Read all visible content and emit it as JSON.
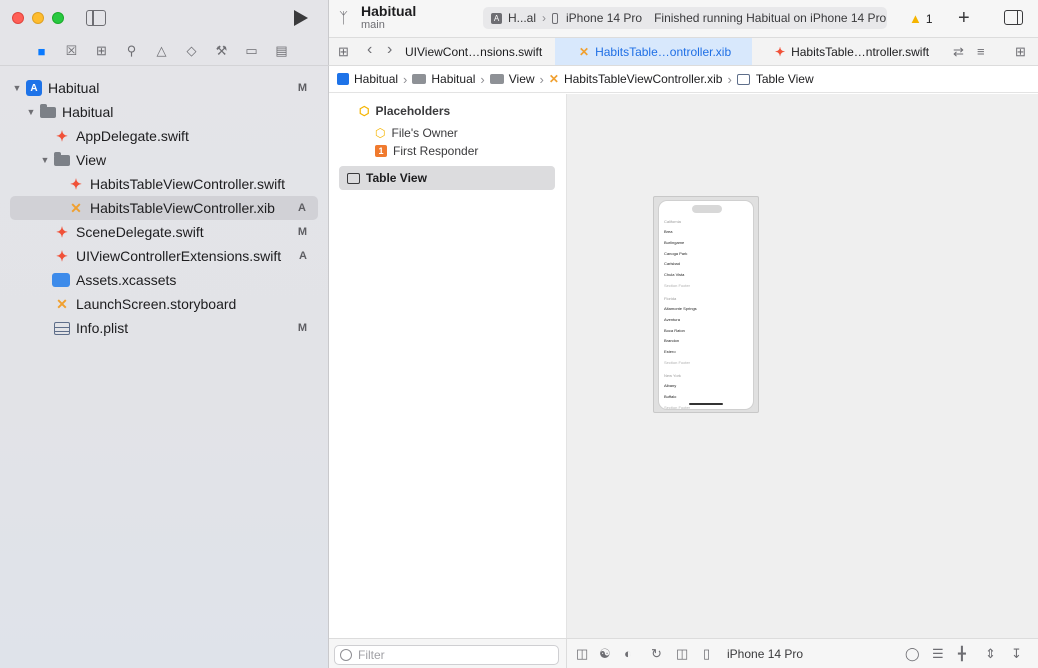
{
  "window": {
    "project_name": "Habitual",
    "branch": "main"
  },
  "activity": {
    "scheme": "H...al",
    "destination": "iPhone 14 Pro",
    "status": "Finished running Habitual on iPhone 14 Pro"
  },
  "toolbar": {
    "warning_count": "1"
  },
  "navigator": {
    "tree": [
      {
        "label": "Habitual",
        "badge": "M",
        "kind": "project"
      },
      {
        "label": "Habitual",
        "badge": "",
        "kind": "folder"
      },
      {
        "label": "AppDelegate.swift",
        "badge": "",
        "kind": "swift"
      },
      {
        "label": "View",
        "badge": "",
        "kind": "folder"
      },
      {
        "label": "HabitsTableViewController.swift",
        "badge": "",
        "kind": "swift"
      },
      {
        "label": "HabitsTableViewController.xib",
        "badge": "A",
        "kind": "xib"
      },
      {
        "label": "SceneDelegate.swift",
        "badge": "M",
        "kind": "swift"
      },
      {
        "label": "UIViewControllerExtensions.swift",
        "badge": "A",
        "kind": "swift"
      },
      {
        "label": "Assets.xcassets",
        "badge": "",
        "kind": "assets"
      },
      {
        "label": "LaunchScreen.storyboard",
        "badge": "",
        "kind": "xib"
      },
      {
        "label": "Info.plist",
        "badge": "M",
        "kind": "plist"
      }
    ]
  },
  "tabs": [
    {
      "label": "UIViewCont…nsions.swift"
    },
    {
      "label": "HabitsTable…ontroller.xib"
    },
    {
      "label": "HabitsTable…ntroller.swift"
    }
  ],
  "jumpbar": [
    {
      "label": "Habitual"
    },
    {
      "label": "Habitual"
    },
    {
      "label": "View"
    },
    {
      "label": "HabitsTableViewController.xib"
    },
    {
      "label": "Table View"
    }
  ],
  "outline": {
    "placeholders": "Placeholders",
    "files_owner": "File's Owner",
    "first_responder": "First Responder",
    "first_responder_num": "1",
    "table_view": "Table View"
  },
  "preview": {
    "lines": [
      {
        "t": "California",
        "k": "hdr"
      },
      {
        "t": "Brea",
        "k": "cell"
      },
      {
        "t": "Burlingame",
        "k": "cell"
      },
      {
        "t": "Canoga Park",
        "k": "cell"
      },
      {
        "t": "Carlsbad",
        "k": "cell"
      },
      {
        "t": "Chula Vista",
        "k": "cell"
      },
      {
        "t": "Section Footer",
        "k": "ftr"
      },
      {
        "t": "Florida",
        "k": "hdr"
      },
      {
        "t": "Altamonte Springs",
        "k": "cell"
      },
      {
        "t": "Aventura",
        "k": "cell"
      },
      {
        "t": "Boca Raton",
        "k": "cell"
      },
      {
        "t": "Brandon",
        "k": "cell"
      },
      {
        "t": "Estero",
        "k": "cell"
      },
      {
        "t": "Section Footer",
        "k": "ftr"
      },
      {
        "t": "New York",
        "k": "hdr"
      },
      {
        "t": "Albany",
        "k": "cell"
      },
      {
        "t": "Buffalo",
        "k": "cell"
      },
      {
        "t": "Section Footer",
        "k": "ftr"
      }
    ]
  },
  "filter": {
    "placeholder": "Filter"
  },
  "canvas_bar": {
    "device": "iPhone 14 Pro"
  }
}
